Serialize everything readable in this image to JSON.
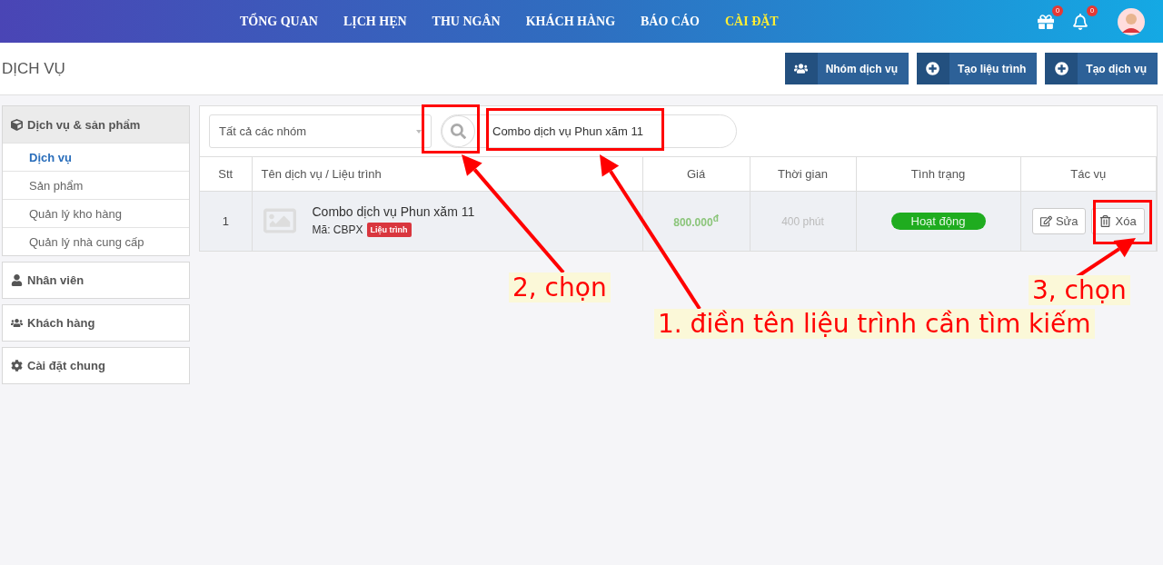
{
  "nav": {
    "items": [
      {
        "label": "TỔNG QUAN",
        "selected": false
      },
      {
        "label": "LỊCH HẸN",
        "selected": false
      },
      {
        "label": "THU NGÂN",
        "selected": false
      },
      {
        "label": "KHÁCH HÀNG",
        "selected": false
      },
      {
        "label": "BÁO CÁO",
        "selected": false
      },
      {
        "label": "CÀI ĐẶT",
        "selected": true
      }
    ],
    "notifications": [
      {
        "kind": "gift",
        "count": "0"
      },
      {
        "kind": "bell",
        "count": "0"
      }
    ]
  },
  "page_title": "DỊCH VỤ",
  "header_buttons": [
    {
      "label": "Nhóm dịch vụ"
    },
    {
      "label": "Tạo liệu trình"
    },
    {
      "label": "Tạo dịch vụ"
    }
  ],
  "sidebar": {
    "groups": [
      {
        "label": "Dịch vụ & sản phẩm",
        "expanded": true,
        "children": [
          {
            "label": "Dịch vụ",
            "selected": true
          },
          {
            "label": "Sản phẩm",
            "selected": false
          },
          {
            "label": "Quản lý kho hàng",
            "selected": false
          },
          {
            "label": "Quản lý nhà cung cấp",
            "selected": false
          }
        ]
      },
      {
        "label": "Nhân viên",
        "expanded": false
      },
      {
        "label": "Khách hàng",
        "expanded": false
      },
      {
        "label": "Cài đặt chung",
        "expanded": false
      }
    ]
  },
  "filter": {
    "group_select": "Tất cả các nhóm",
    "search": {
      "value": "Combo dịch vụ Phun xăm 11"
    }
  },
  "table": {
    "columns": [
      "Stt",
      "Tên dịch vụ / Liệu trình",
      "Giá",
      "Thời gian",
      "Tình trạng",
      "Tác vụ"
    ],
    "rows": [
      {
        "stt": "1",
        "name": "Combo dịch vụ Phun xăm 11",
        "code": "Mã: CBPX",
        "tag": "Liệu trình",
        "price": "800.000$^{đ}$",
        "duration": "400 phút",
        "status": "Hoạt động",
        "active": true,
        "actions": [
          "Sửa",
          "Xóa"
        ]
      }
    ]
  },
  "annotations": [
    {
      "text": "1. điền tên liệu trình cần tìm kiếm"
    },
    {
      "text": "2, chọn"
    },
    {
      "text": "3, chọn"
    }
  ]
}
